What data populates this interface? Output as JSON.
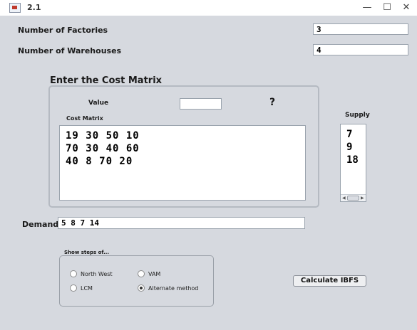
{
  "window": {
    "title": "2.1",
    "minimize": "—",
    "maximize": "☐",
    "close": "✕"
  },
  "factories": {
    "label": "Number of Factories",
    "value": "3"
  },
  "warehouses": {
    "label": "Number of Warehouses",
    "value": "4"
  },
  "cost_panel": {
    "title": "Enter the Cost Matrix",
    "value_label": "Value",
    "value_field": "",
    "help": "?",
    "matrix_label": "Cost Matrix",
    "rows": [
      "19   30   50   10",
      "70   30   40   60",
      "40   8   70   20"
    ]
  },
  "supply": {
    "label": "Supply",
    "values": [
      "7",
      "9",
      "18"
    ]
  },
  "demand": {
    "label": "Demand",
    "value": "5 8 7 14"
  },
  "steps": {
    "title": "Show steps of...",
    "options": [
      "North West",
      "VAM",
      "LCM",
      "Alternate method"
    ],
    "selected": "Alternate method"
  },
  "calculate_button": "Calculate IBFS"
}
